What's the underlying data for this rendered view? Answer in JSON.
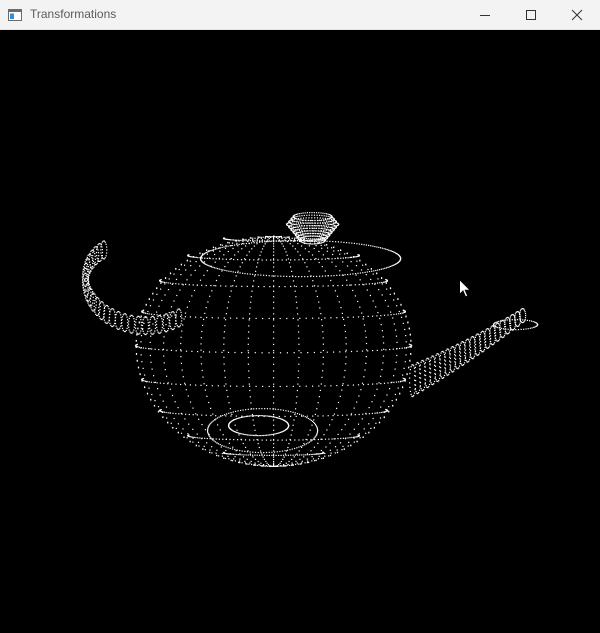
{
  "window": {
    "title": "Transformations",
    "icon": "app-window-icon",
    "controls": [
      "minimize-icon",
      "maximize-icon",
      "close-icon"
    ]
  },
  "viewport": {
    "background": "#000000",
    "point_color": "#ffffff",
    "object": "teapot-point-cloud"
  }
}
